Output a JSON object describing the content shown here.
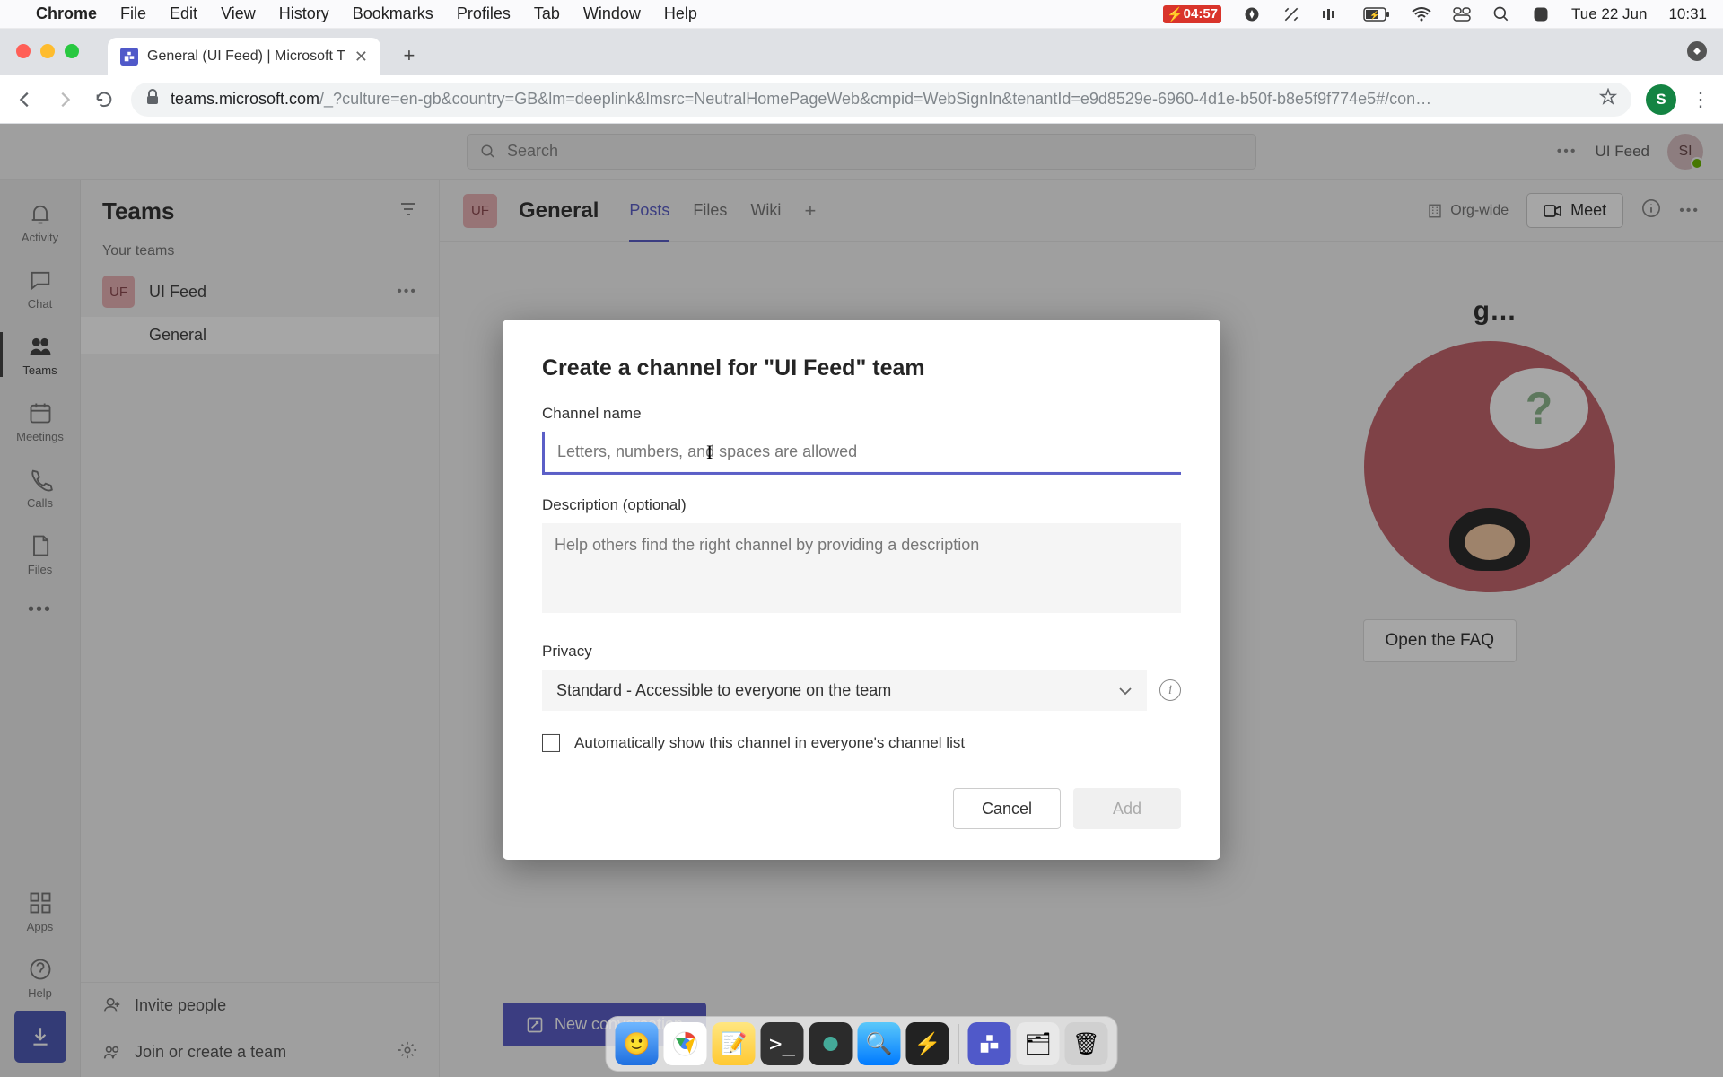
{
  "menubar": {
    "app": "Chrome",
    "items": [
      "File",
      "Edit",
      "View",
      "History",
      "Bookmarks",
      "Profiles",
      "Tab",
      "Window",
      "Help"
    ],
    "battery_time": "04:57",
    "date": "Tue 22 Jun",
    "clock": "10:31"
  },
  "browser": {
    "tab_title": "General (UI Feed) | Microsoft T",
    "url_host": "teams.microsoft.com",
    "url_path": "/_?culture=en-gb&country=GB&lm=deeplink&lmsrc=NeutralHomePageWeb&cmpid=WebSignIn&tenantId=e9d8529e-6960-4d1e-b50f-b8e5f9f774e5#/con…",
    "profile_initial": "S"
  },
  "teams_header": {
    "search_placeholder": "Search",
    "org_name": "UI Feed",
    "avatar_initials": "SI"
  },
  "rail": {
    "items": [
      {
        "label": "Activity"
      },
      {
        "label": "Chat"
      },
      {
        "label": "Teams"
      },
      {
        "label": "Meetings"
      },
      {
        "label": "Calls"
      },
      {
        "label": "Files"
      }
    ],
    "more": "•••",
    "apps": "Apps",
    "help": "Help"
  },
  "panel": {
    "title": "Teams",
    "section": "Your teams",
    "team_badge": "UF",
    "team_name": "UI Feed",
    "channel": "General",
    "invite": "Invite people",
    "join": "Join or create a team"
  },
  "content": {
    "badge": "UF",
    "title": "General",
    "tabs": [
      "Posts",
      "Files",
      "Wiki"
    ],
    "org_wide": "Org-wide",
    "meet": "Meet",
    "welcome_hint": "g…",
    "faq": "Open the FAQ",
    "new_conversation": "New conversation",
    "bubble_q": "?"
  },
  "modal": {
    "title": "Create a channel for \"UI Feed\" team",
    "name_label": "Channel name",
    "name_placeholder": "Letters, numbers, and spaces are allowed",
    "desc_label": "Description (optional)",
    "desc_placeholder": "Help others find the right channel by providing a description",
    "privacy_label": "Privacy",
    "privacy_value": "Standard - Accessible to everyone on the team",
    "auto_show": "Automatically show this channel in everyone's channel list",
    "cancel": "Cancel",
    "add": "Add"
  }
}
